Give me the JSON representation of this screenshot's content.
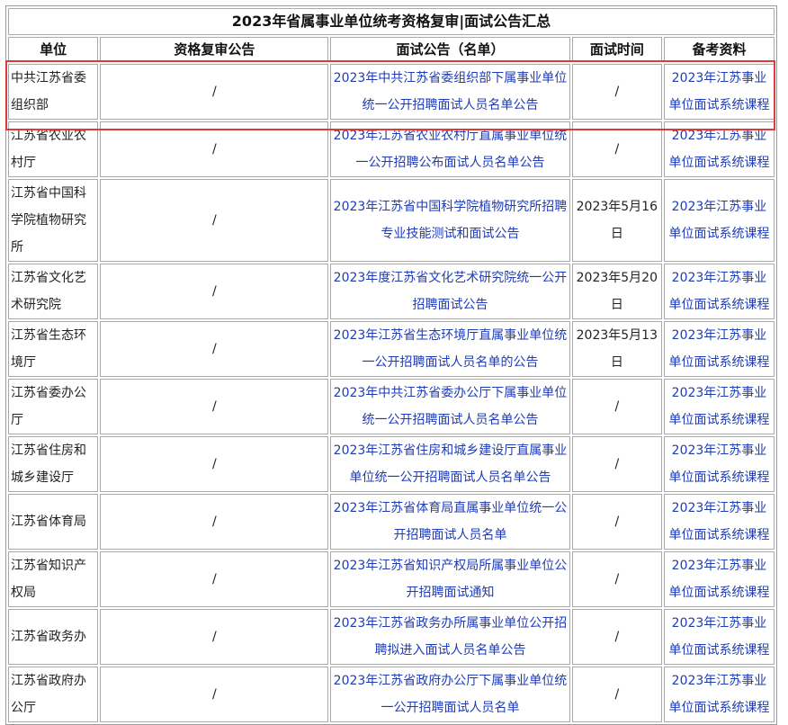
{
  "title": "2023年省属事业单位统考资格复审|面试公告汇总",
  "headers": {
    "unit": "单位",
    "review": "资格复审公告",
    "interview": "面试公告（名单）",
    "time": "面试时间",
    "material": "备考资料"
  },
  "rows": [
    {
      "unit": "中共江苏省委组织部",
      "review": "/",
      "notice": "2023年中共江苏省委组织部下属事业单位统一公开招聘面试人员名单公告",
      "time": "/",
      "material": "2023年江苏事业单位面试系统课程"
    },
    {
      "unit": "江苏省农业农村厅",
      "review": "/",
      "notice": "2023年江苏省农业农村厅直属事业单位统一公开招聘公布面试人员名单公告",
      "time": "/",
      "material": "2023年江苏事业单位面试系统课程"
    },
    {
      "unit": "江苏省中国科学院植物研究所",
      "review": "/",
      "notice": "2023年江苏省中国科学院植物研究所招聘专业技能测试和面试公告",
      "time": "2023年5月16日",
      "material": "2023年江苏事业单位面试系统课程"
    },
    {
      "unit": "江苏省文化艺术研究院",
      "review": "/",
      "notice": "2023年度江苏省文化艺术研究院统一公开招聘面试公告",
      "time": "2023年5月20日",
      "material": "2023年江苏事业单位面试系统课程"
    },
    {
      "unit": "江苏省生态环境厅",
      "review": "/",
      "notice": "2023年江苏省生态环境厅直属事业单位统一公开招聘面试人员名单的公告",
      "time": "2023年5月13日",
      "material": "2023年江苏事业单位面试系统课程"
    },
    {
      "unit": "江苏省委办公厅",
      "review": "/",
      "notice": "2023年中共江苏省委办公厅下属事业单位统一公开招聘面试人员名单公告",
      "time": "/",
      "material": "2023年江苏事业单位面试系统课程"
    },
    {
      "unit": "江苏省住房和城乡建设厅",
      "review": "/",
      "notice": "2023年江苏省住房和城乡建设厅直属事业单位统一公开招聘面试人员名单公告",
      "time": "/",
      "material": "2023年江苏事业单位面试系统课程"
    },
    {
      "unit": "江苏省体育局",
      "review": "/",
      "notice": "2023年江苏省体育局直属事业单位统一公开招聘面试人员名单",
      "time": "/",
      "material": "2023年江苏事业单位面试系统课程"
    },
    {
      "unit": "江苏省知识产权局",
      "review": "/",
      "notice": "2023年江苏省知识产权局所属事业单位公开招聘面试通知",
      "time": "/",
      "material": "2023年江苏事业单位面试系统课程"
    },
    {
      "unit": "江苏省政务办",
      "review": "/",
      "notice": "2023年江苏省政务办所属事业单位公开招聘拟进入面试人员名单公告",
      "time": "/",
      "material": "2023年江苏事业单位面试系统课程"
    },
    {
      "unit": "江苏省政府办公厅",
      "review": "/",
      "notice": "2023年江苏省政府办公厅下属事业单位统一公开招聘面试人员名单",
      "time": "/",
      "material": "2023年江苏事业单位面试系统课程"
    }
  ]
}
